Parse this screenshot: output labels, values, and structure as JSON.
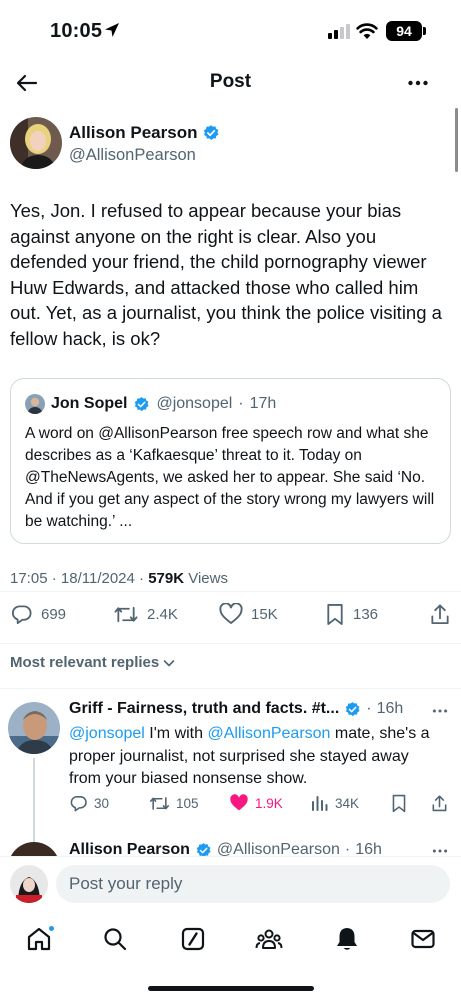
{
  "status_bar": {
    "time": "10:05",
    "battery": "94"
  },
  "header": {
    "title": "Post"
  },
  "author": {
    "name": "Allison Pearson",
    "handle": "@AllisonPearson"
  },
  "post": {
    "text": "Yes, Jon. I refused to appear because your bias against anyone on the right is clear. Also you defended your friend, the child pornography viewer Huw Edwards, and attacked those who called him out. Yet, as a journalist, you think the police visiting a fellow hack, is ok?"
  },
  "quote": {
    "name": "Jon Sopel",
    "handle": "@jonsopel",
    "separator": "·",
    "time": "17h",
    "text": "A word on @AllisonPearson free speech row and what she describes as a ‘Kafkaesque’ threat to it. Today  on @TheNewsAgents, we asked her to appear. She said ‘No. And if you get any aspect of the story wrong my lawyers will be watching.’ ..."
  },
  "meta": {
    "time": "17:05",
    "date": "18/11/2024",
    "separator": "·",
    "views_count": "579K",
    "views_label": "Views"
  },
  "stats": {
    "replies": "699",
    "reposts": "2.4K",
    "likes": "15K",
    "bookmarks": "136"
  },
  "replies_filter": {
    "label": "Most relevant replies"
  },
  "reply": {
    "name": "Griff - Fairness, truth and facts. #t...",
    "separator": "·",
    "time": "16h",
    "mention1": "@jonsopel",
    "text1": " I'm with ",
    "mention2": "@AllisonPearson",
    "text2": " mate, she's a proper journalist, not surprised she stayed away from your biased nonsense show.",
    "replies": "30",
    "reposts": "105",
    "likes": "1.9K",
    "views": "34K"
  },
  "next_reply": {
    "name": "Allison Pearson",
    "handle": "@AllisonPearson",
    "separator": "·",
    "time": "16h"
  },
  "composer": {
    "placeholder": "Post your reply"
  },
  "colors": {
    "accent": "#1d9bf0",
    "like": "#f91880",
    "muted": "#536471",
    "text": "#0f1419"
  }
}
